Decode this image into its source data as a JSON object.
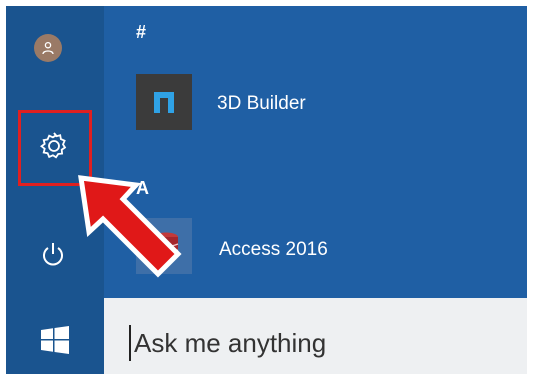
{
  "start_menu": {
    "groups": [
      {
        "header": "#",
        "apps": [
          {
            "name": "3D Builder",
            "icon": "3d-builder-icon",
            "tile_color": "#3b3b3b"
          }
        ]
      },
      {
        "header": "A",
        "apps": [
          {
            "name": "Access 2016",
            "icon": "access-icon",
            "tile_color": "#a4262c"
          }
        ]
      }
    ]
  },
  "rail": {
    "icons": [
      "user-icon",
      "gear-icon",
      "power-icon",
      "windows-logo-icon"
    ]
  },
  "search": {
    "placeholder": "Ask me anything"
  },
  "colors": {
    "accent": "#1f5fa4",
    "rail": "#1a548f",
    "annotation": "#e02020"
  }
}
